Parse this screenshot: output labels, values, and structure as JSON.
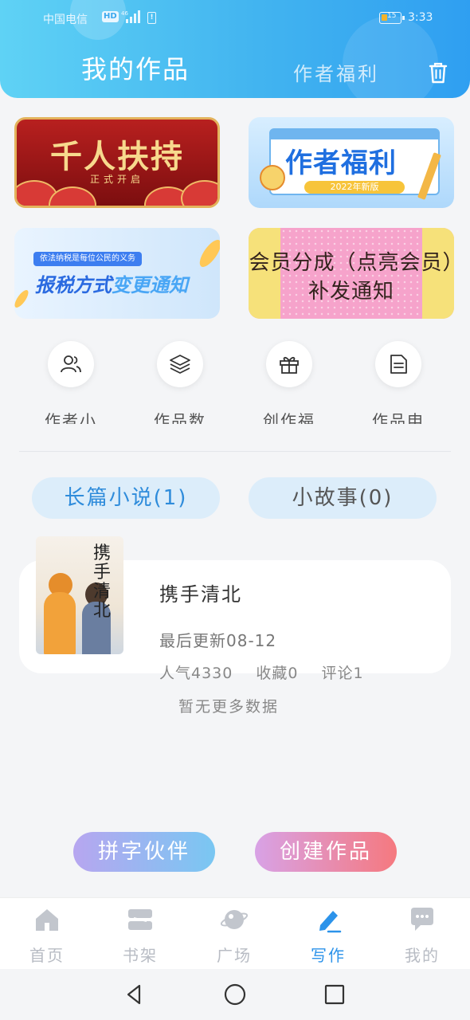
{
  "status_bar": {
    "carrier": "中国电信",
    "network": "HD",
    "signal_label": "46",
    "alert": "!",
    "battery_level": "15",
    "time": "3:33"
  },
  "header": {
    "title": "我的作品",
    "welfare_link": "作者福利",
    "trash_icon": "trash-icon"
  },
  "banners": [
    {
      "title": "千人扶持",
      "subtitle": "正式开启"
    },
    {
      "title": "作者福利",
      "badge": "2022年新版"
    },
    {
      "tag": "依法纳税是每位公民的义务",
      "title_main": "报税方式",
      "title_accent": "变更通知"
    },
    {
      "text": "会员分成（点亮会员）补发通知"
    }
  ],
  "quick_links": [
    {
      "label": "作者小",
      "icon": "users-icon"
    },
    {
      "label": "作品数",
      "icon": "layers-icon"
    },
    {
      "label": "创作福",
      "icon": "gift-icon"
    },
    {
      "label": "作品申",
      "icon": "document-icon"
    }
  ],
  "tabs": {
    "long": "长篇小说(1)",
    "short": "小故事(0)",
    "active": "long"
  },
  "work": {
    "cover_title": "携手清北",
    "title": "携手清北",
    "updated": "最后更新08-12",
    "popularity": "人气4330",
    "favorites": "收藏0",
    "comments": "评论1"
  },
  "no_more": "暂无更多数据",
  "actions": {
    "partner": "拼字伙伴",
    "create": "创建作品"
  },
  "bottom_nav": [
    {
      "label": "首页",
      "icon": "home-icon"
    },
    {
      "label": "书架",
      "icon": "bookshelf-icon"
    },
    {
      "label": "广场",
      "icon": "planet-icon"
    },
    {
      "label": "写作",
      "icon": "pen-icon",
      "active": true
    },
    {
      "label": "我的",
      "icon": "chat-bubble-icon"
    }
  ],
  "colors": {
    "header_start": "#5fd2f5",
    "header_end": "#2f9ff1",
    "accent": "#2c93ea",
    "nav_inactive": "#b8bcc4"
  }
}
